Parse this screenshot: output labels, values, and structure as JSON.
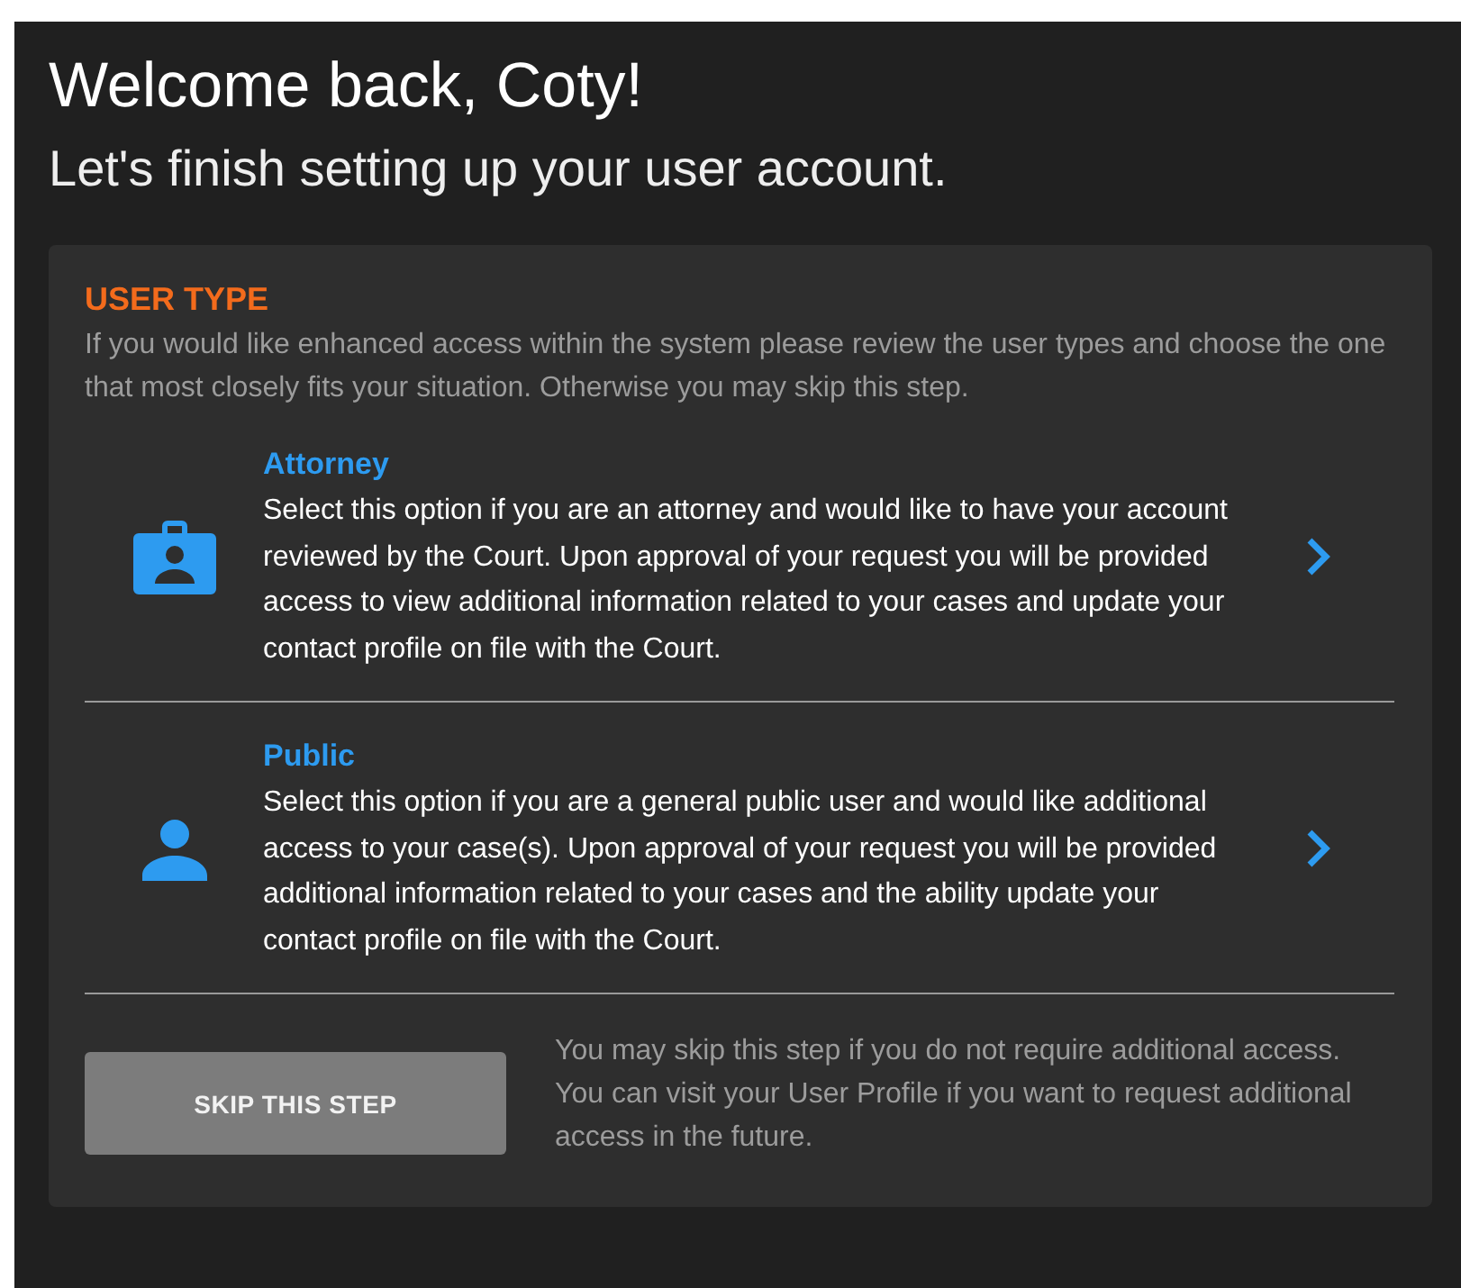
{
  "heading": "Welcome back, Coty!",
  "subheading": "Let's finish setting up your user account.",
  "card": {
    "title": "USER TYPE",
    "intro": "If you would like enhanced access within the system please review the user types and choose the one that most closely fits your situation. Otherwise you may skip this step.",
    "options": [
      {
        "kind": "attorney",
        "title": "Attorney",
        "description": "Select this option if you are an attorney and would like to have your account reviewed by the Court. Upon approval of your request you will be provided access to view additional information related to your cases and update your contact profile on file with the Court."
      },
      {
        "kind": "public",
        "title": "Public",
        "description": "Select this option if you are a general public user and would like additional access to your case(s). Upon approval of your request you will be provided additional information related to your cases and the ability update your contact profile on file with the Court."
      }
    ],
    "skip_button": "SKIP THIS STEP",
    "skip_note": "You may skip this step if you do not require additional access. You can visit your User Profile if you want to request additional access in the future."
  }
}
